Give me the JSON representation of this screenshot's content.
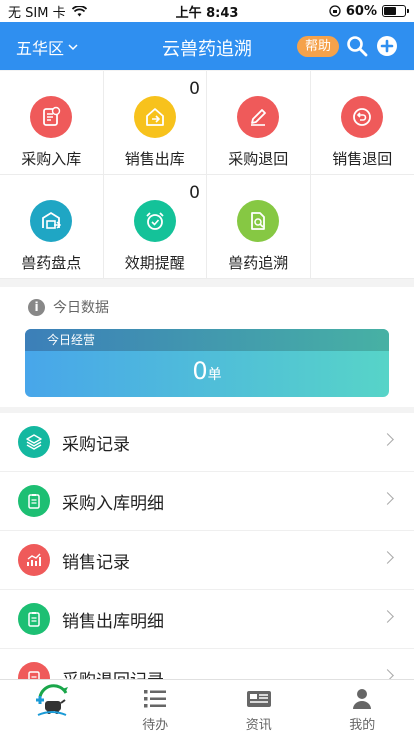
{
  "status_bar": {
    "carrier": "无 SIM 卡",
    "time": "上午 8:43",
    "battery_percent": "60%",
    "battery_level": 0.6
  },
  "header": {
    "district": "五华区",
    "title": "云兽药追溯",
    "help_label": "帮助",
    "search_icon": "search-icon",
    "add_icon": "plus-circle-icon",
    "color": "#2f8ff0"
  },
  "grid": {
    "items": [
      {
        "label": "采购入库",
        "icon": "clipboard-icon",
        "color": "#ef5a5a",
        "badge": ""
      },
      {
        "label": "销售出库",
        "icon": "house-out-icon",
        "color": "#f7c21c",
        "badge": "0"
      },
      {
        "label": "采购退回",
        "icon": "pencil-icon",
        "color": "#ef5a5a",
        "badge": ""
      },
      {
        "label": "销售退回",
        "icon": "return-icon",
        "color": "#ef5a5a",
        "badge": ""
      },
      {
        "label": "兽药盘点",
        "icon": "warehouse-icon",
        "color": "#1fa6c4",
        "badge": ""
      },
      {
        "label": "效期提醒",
        "icon": "alarm-clock-icon",
        "color": "#14c299",
        "badge": "0"
      },
      {
        "label": "兽药追溯",
        "icon": "document-search-icon",
        "color": "#86c843",
        "badge": ""
      }
    ]
  },
  "today": {
    "heading": "今日数据",
    "card_title": "今日经营",
    "value": "0",
    "unit": "单"
  },
  "list": {
    "items": [
      {
        "label": "采购记录",
        "icon": "layers-icon",
        "color": "#14b8a0"
      },
      {
        "label": "采购入库明细",
        "icon": "clipboard-icon",
        "color": "#1dbf73"
      },
      {
        "label": "销售记录",
        "icon": "chart-icon",
        "color": "#ef5a5a"
      },
      {
        "label": "销售出库明细",
        "icon": "clipboard-icon",
        "color": "#1dbf73"
      },
      {
        "label": "采购退回记录",
        "icon": "clipboard-icon",
        "color": "#ef5a5a"
      }
    ]
  },
  "tabbar": {
    "items": [
      {
        "label": "",
        "icon": "home-logo-icon"
      },
      {
        "label": "待办",
        "icon": "list-icon"
      },
      {
        "label": "资讯",
        "icon": "newspaper-icon"
      },
      {
        "label": "我的",
        "icon": "user-icon"
      }
    ]
  }
}
